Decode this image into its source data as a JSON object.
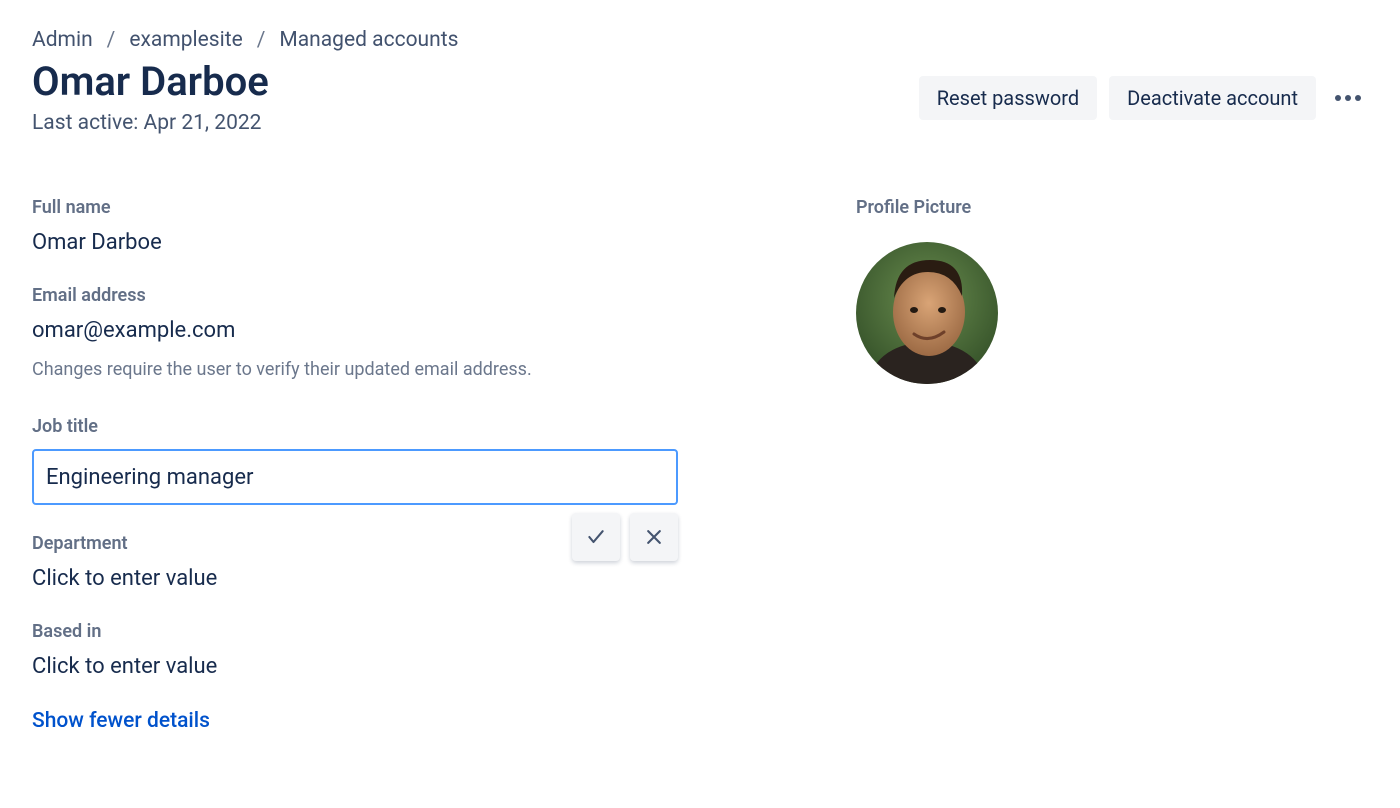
{
  "breadcrumb": {
    "items": [
      "Admin",
      "examplesite",
      "Managed accounts"
    ]
  },
  "header": {
    "title": "Omar Darboe",
    "last_active": "Last active: Apr 21, 2022",
    "actions": {
      "reset_password": "Reset password",
      "deactivate_account": "Deactivate account"
    }
  },
  "fields": {
    "full_name": {
      "label": "Full name",
      "value": "Omar Darboe"
    },
    "email": {
      "label": "Email address",
      "value": "omar@example.com",
      "helper": "Changes require the user to verify their updated email address."
    },
    "job_title": {
      "label": "Job title",
      "value": "Engineering manager"
    },
    "department": {
      "label": "Department",
      "placeholder": "Click to enter value"
    },
    "based_in": {
      "label": "Based in",
      "placeholder": "Click to enter value"
    }
  },
  "toggle_details": "Show fewer details",
  "profile_picture": {
    "label": "Profile Picture"
  }
}
